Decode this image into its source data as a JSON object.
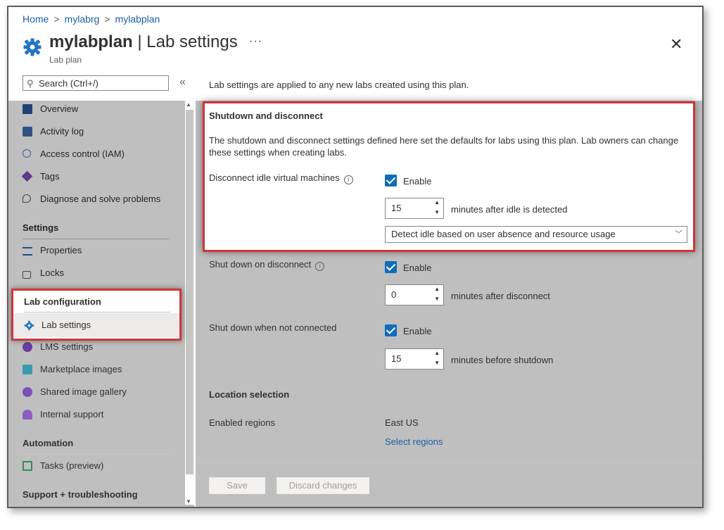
{
  "breadcrumb": [
    "Home",
    "mylabrg",
    "mylabplan"
  ],
  "header": {
    "resource_name": "mylabplan",
    "separator": " | ",
    "page_name": "Lab settings",
    "subtitle": "Lab plan",
    "more": "···",
    "close": "✕"
  },
  "sidebar": {
    "search_placeholder": "Search (Ctrl+/)",
    "collapse": "«",
    "items_top": [
      {
        "label": "Overview",
        "icon": "overview-icon"
      },
      {
        "label": "Activity log",
        "icon": "activity-log-icon"
      },
      {
        "label": "Access control (IAM)",
        "icon": "iam-icon"
      },
      {
        "label": "Tags",
        "icon": "tag-icon"
      },
      {
        "label": "Diagnose and solve problems",
        "icon": "wrench-icon"
      }
    ],
    "settings_heading": "Settings",
    "settings_items": [
      {
        "label": "Properties",
        "icon": "properties-icon"
      },
      {
        "label": "Locks",
        "icon": "lock-icon"
      }
    ],
    "lab_config_heading": "Lab configuration",
    "lab_config_items": [
      {
        "label": "Lab settings",
        "icon": "gear-icon"
      },
      {
        "label": "LMS settings",
        "icon": "lms-icon"
      },
      {
        "label": "Marketplace images",
        "icon": "marketplace-icon"
      },
      {
        "label": "Shared image gallery",
        "icon": "gallery-icon"
      },
      {
        "label": "Internal support",
        "icon": "support-icon"
      }
    ],
    "automation_heading": "Automation",
    "automation_items": [
      {
        "label": "Tasks (preview)",
        "icon": "tasks-icon"
      }
    ],
    "support_heading": "Support + troubleshooting"
  },
  "main": {
    "intro": "Lab settings are applied to any new labs created using this plan.",
    "shutdown": {
      "heading": "Shutdown and disconnect",
      "description": "The shutdown and disconnect settings defined here set the defaults for labs using this plan. Lab owners can change these settings when creating labs.",
      "idle_label": "Disconnect idle virtual machines",
      "idle_enable": "Enable",
      "idle_minutes": "15",
      "idle_suffix": "minutes after idle is detected",
      "idle_mode": "Detect idle based on user absence and resource usage",
      "disconnect_label": "Shut down on disconnect",
      "disconnect_enable": "Enable",
      "disconnect_minutes": "0",
      "disconnect_suffix": "minutes after disconnect",
      "notconnected_label": "Shut down when not connected",
      "notconnected_enable": "Enable",
      "notconnected_minutes": "15",
      "notconnected_suffix": "minutes before shutdown"
    },
    "location": {
      "heading": "Location selection",
      "regions_label": "Enabled regions",
      "regions_value": "East US",
      "select_link": "Select regions"
    },
    "footer": {
      "save": "Save",
      "discard": "Discard changes"
    }
  },
  "colors": {
    "accent": "#0f6cbd",
    "highlight": "#d13438",
    "link": "#1c5fa8"
  }
}
